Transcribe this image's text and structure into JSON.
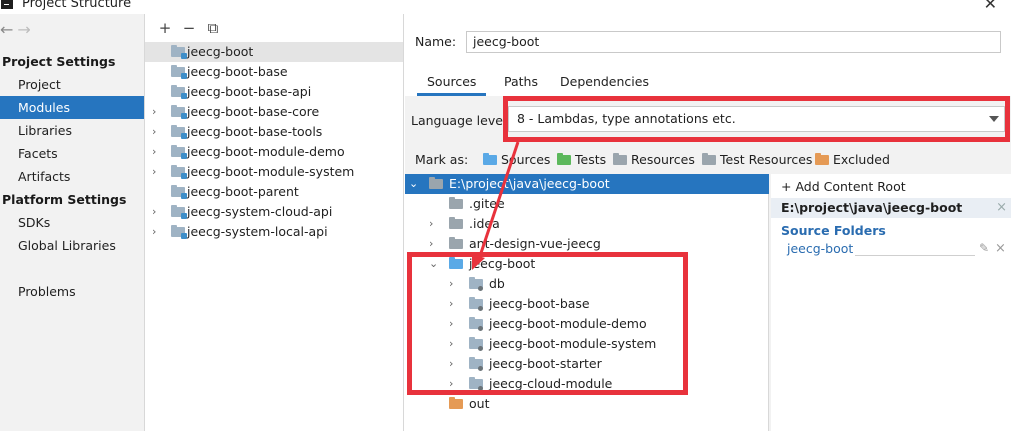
{
  "window": {
    "title": "Project Structure",
    "close_glyph": "✕"
  },
  "sidebar": {
    "nav_back": "←",
    "nav_forward": "→",
    "project_settings_heading": "Project Settings",
    "project_settings": [
      "Project",
      "Modules",
      "Libraries",
      "Facets",
      "Artifacts"
    ],
    "platform_settings_heading": "Platform Settings",
    "platform_settings": [
      "SDKs",
      "Global Libraries"
    ],
    "problems": "Problems",
    "selected": "Modules"
  },
  "module_list": {
    "toolbar": {
      "add": "+",
      "remove": "−",
      "copy": "⧉"
    },
    "items": [
      {
        "name": "jeecg-boot",
        "expandable": false,
        "selected": true
      },
      {
        "name": "jeecg-boot-base",
        "expandable": false
      },
      {
        "name": "jeecg-boot-base-api",
        "expandable": false
      },
      {
        "name": "jeecg-boot-base-core",
        "expandable": true
      },
      {
        "name": "jeecg-boot-base-tools",
        "expandable": true
      },
      {
        "name": "jeecg-boot-module-demo",
        "expandable": true
      },
      {
        "name": "jeecg-boot-module-system",
        "expandable": true
      },
      {
        "name": "jeecg-boot-parent",
        "expandable": false
      },
      {
        "name": "jeecg-system-cloud-api",
        "expandable": true
      },
      {
        "name": "jeecg-system-local-api",
        "expandable": true
      }
    ]
  },
  "module_detail": {
    "name_label": "Name:",
    "name_value": "jeecg-boot",
    "tabs": [
      "Sources",
      "Paths",
      "Dependencies"
    ],
    "active_tab": "Sources",
    "language_level_label": "Language level:",
    "language_level_value": "8 - Lambdas, type annotations etc.",
    "mark_as_label": "Mark as:",
    "mark_as": [
      {
        "label": "Sources",
        "icon": "sources-folder-icon"
      },
      {
        "label": "Tests",
        "icon": "tests-folder-icon"
      },
      {
        "label": "Resources",
        "icon": "resources-folder-icon"
      },
      {
        "label": "Test Resources",
        "icon": "test-resources-folder-icon"
      },
      {
        "label": "Excluded",
        "icon": "excluded-folder-icon"
      }
    ],
    "tree": [
      {
        "label": "E:\\project\\java\\jeecg-boot",
        "level": 0,
        "chev": "⌄",
        "selected": true,
        "kind": "gray"
      },
      {
        "label": ".gitee",
        "level": 1,
        "chev": "",
        "kind": "gray"
      },
      {
        "label": ".idea",
        "level": 1,
        "chev": "›",
        "kind": "gray"
      },
      {
        "label": "ant-design-vue-jeecg",
        "level": 1,
        "chev": "›",
        "kind": "gray"
      },
      {
        "label": "jeecg-boot",
        "level": 1,
        "chev": "⌄",
        "kind": "blue"
      },
      {
        "label": "db",
        "level": 2,
        "chev": "›",
        "kind": "gdot"
      },
      {
        "label": "jeecg-boot-base",
        "level": 2,
        "chev": "›",
        "kind": "gdot"
      },
      {
        "label": "jeecg-boot-module-demo",
        "level": 2,
        "chev": "›",
        "kind": "gdot"
      },
      {
        "label": "jeecg-boot-module-system",
        "level": 2,
        "chev": "›",
        "kind": "gdot"
      },
      {
        "label": "jeecg-boot-starter",
        "level": 2,
        "chev": "›",
        "kind": "gdot"
      },
      {
        "label": "jeecg-cloud-module",
        "level": 2,
        "chev": "›",
        "kind": "gdot"
      },
      {
        "label": "out",
        "level": 1,
        "chev": "",
        "kind": "orange"
      }
    ],
    "content_root": {
      "add_label": "+ Add Content Root",
      "path": "E:\\project\\java\\jeecg-boot",
      "remove": "×",
      "source_folders_title": "Source Folders",
      "source_folder": "jeecg-boot",
      "edit_glyph": "✎",
      "remove_glyph": "×"
    }
  },
  "colors": {
    "selection": "#2675bf",
    "annotation": "#e8323c"
  }
}
